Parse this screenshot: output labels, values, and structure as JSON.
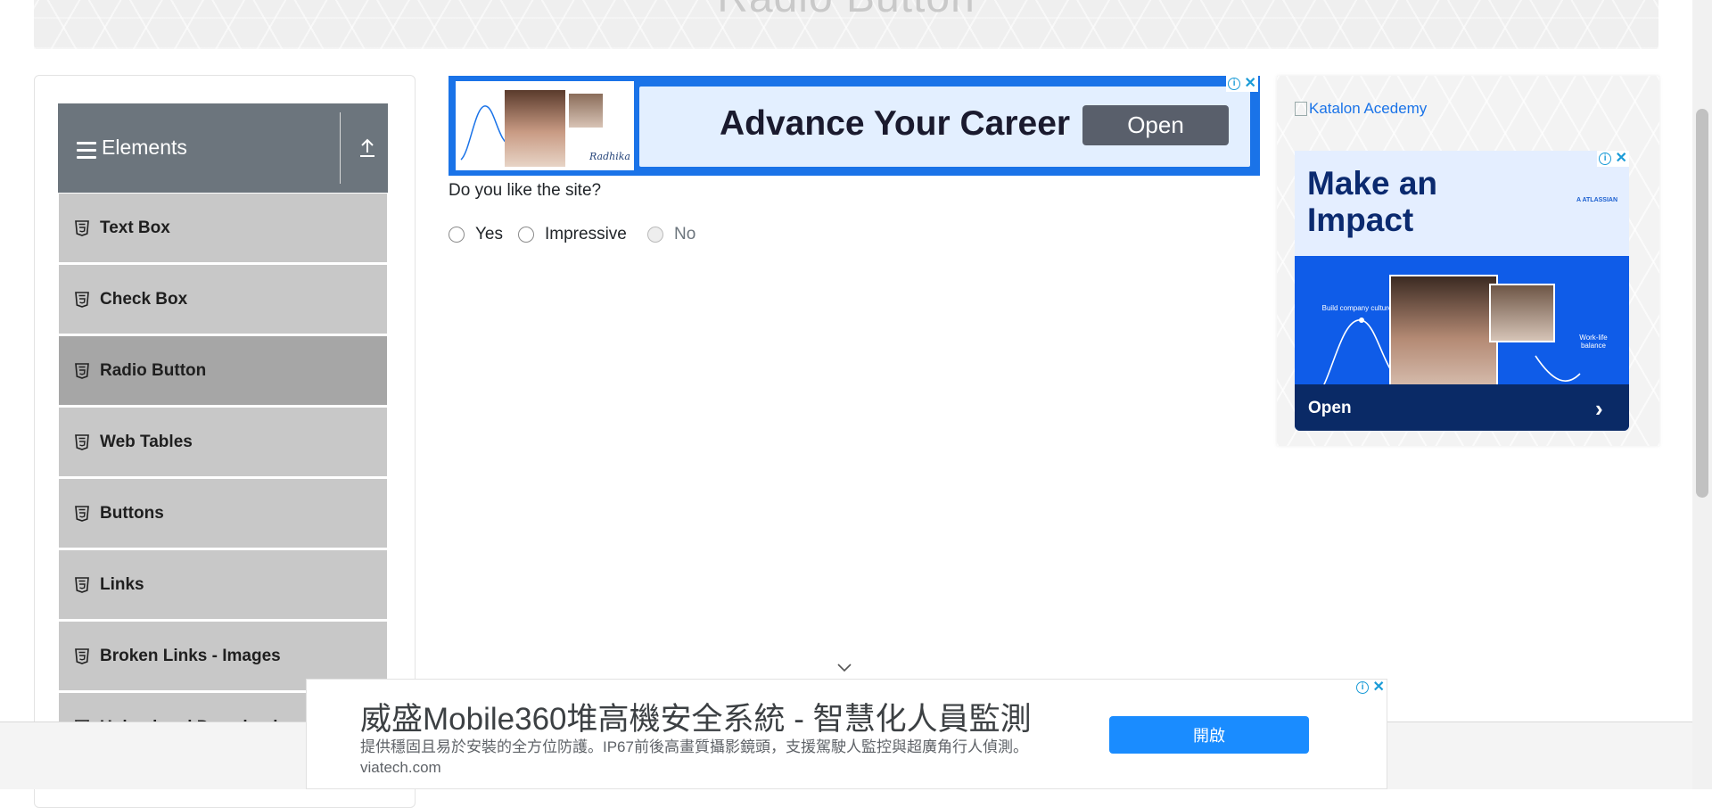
{
  "banner": {
    "title": "Radio Button"
  },
  "sidebar": {
    "group_title": "Elements",
    "items": [
      {
        "label": "Text Box"
      },
      {
        "label": "Check Box"
      },
      {
        "label": "Radio Button"
      },
      {
        "label": "Web Tables"
      },
      {
        "label": "Buttons"
      },
      {
        "label": "Links"
      },
      {
        "label": "Broken Links - Images"
      },
      {
        "label": "Upload and Download"
      }
    ],
    "active_item": "Radio Button"
  },
  "top_ad": {
    "headline": "Advance Your Career",
    "button": "Open",
    "signature": "Radhika"
  },
  "question": {
    "text": "Do you like the site?",
    "options": [
      {
        "label": "Yes",
        "disabled": false
      },
      {
        "label": "Impressive",
        "disabled": false
      },
      {
        "label": "No",
        "disabled": true
      }
    ]
  },
  "right_ad": {
    "alt_link": "Katalon Acedemy",
    "title": "Make an Impact",
    "brand": "A ATLASSIAN",
    "label1": "Build company culture",
    "label2": "Work-life balance",
    "button": "Open"
  },
  "bottom_ad": {
    "title": "威盛Mobile360堆高機安全系統 - 智慧化人員監測",
    "description": "提供穩固且易於安裝的全方位防護。IP67前後高畫質攝影鏡頭，支援駕駛人監控與超廣角行人偵測。 viatech.com",
    "button": "開啟"
  },
  "colors": {
    "sidebar_header": "#6c757d",
    "menu_item": "#c8c8c8",
    "menu_item_active": "#a6a6a6",
    "ad_blue": "#1a73e8",
    "bottom_button": "#1a8cff"
  }
}
